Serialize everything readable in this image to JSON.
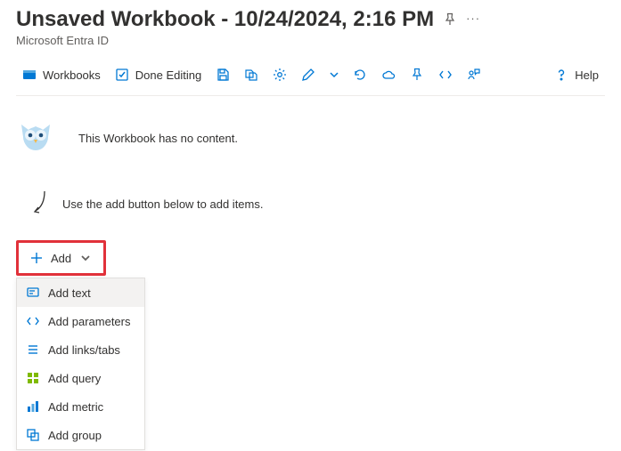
{
  "header": {
    "title": "Unsaved Workbook - 10/24/2024, 2:16 PM",
    "subtitle": "Microsoft Entra ID"
  },
  "toolbar": {
    "workbooks": "Workbooks",
    "done_editing": "Done Editing",
    "help": "Help"
  },
  "empty": {
    "message": "This Workbook has no content.",
    "hint": "Use the add button below to add items."
  },
  "add_button": {
    "label": "Add"
  },
  "add_menu": {
    "items": [
      {
        "label": "Add text"
      },
      {
        "label": "Add parameters"
      },
      {
        "label": "Add links/tabs"
      },
      {
        "label": "Add query"
      },
      {
        "label": "Add metric"
      },
      {
        "label": "Add group"
      }
    ]
  }
}
